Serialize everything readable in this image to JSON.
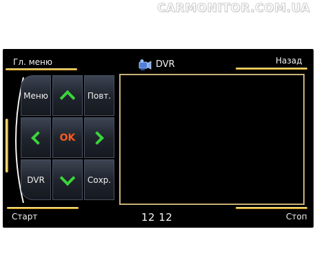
{
  "watermark": "CARMONITOR.COM.UA",
  "header": {
    "main_menu": "Гл. меню",
    "title": "DVR",
    "back": "Назад"
  },
  "title_icon": "video-camera-icon",
  "pad": {
    "menu": "Меню",
    "repeat": "Повт.",
    "ok": "OK",
    "dvr": "DVR",
    "save": "Сохр.",
    "icons": {
      "up": "chevron-up-icon",
      "down": "chevron-down-icon",
      "left": "chevron-left-icon",
      "right": "chevron-right-icon"
    }
  },
  "footer": {
    "start": "Старт",
    "clock": "12 12",
    "stop": "Стоп"
  },
  "colors": {
    "background": "#000000",
    "accent_gold": "#e8c03a",
    "arrow_green": "#3bd43c",
    "ok_orange": "#ff5a1e",
    "video_border": "#c9b27a"
  }
}
